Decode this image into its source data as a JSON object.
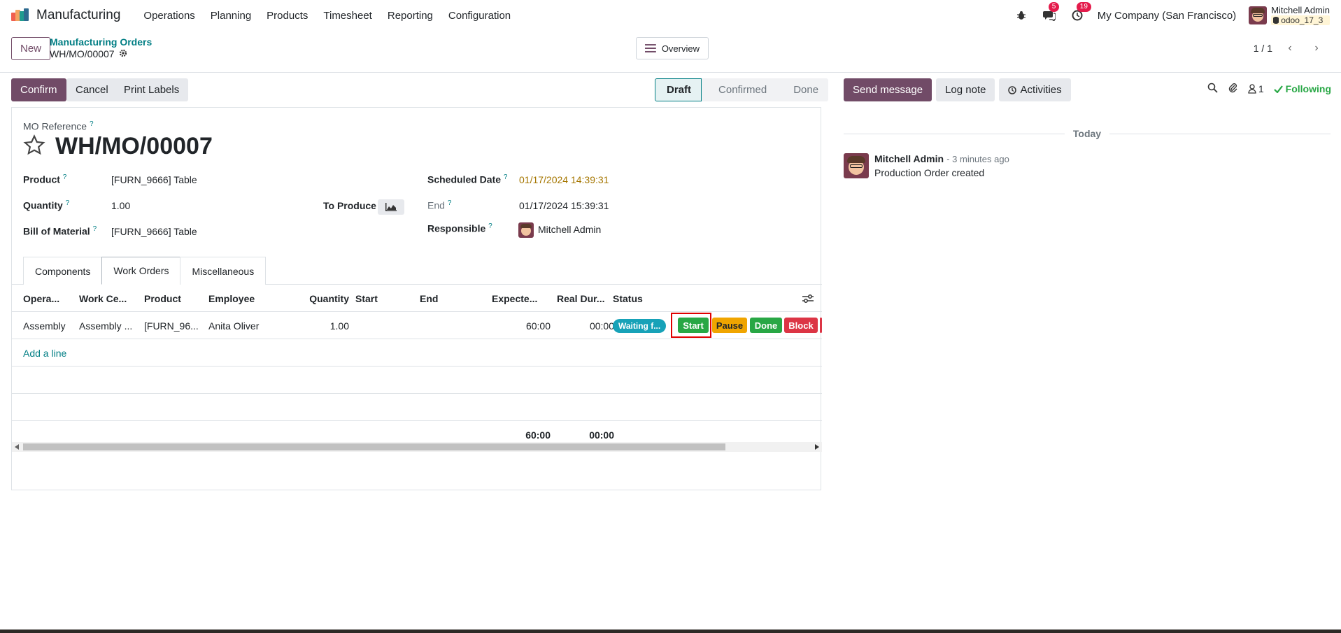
{
  "navbar": {
    "app_name": "Manufacturing",
    "menu": [
      "Operations",
      "Planning",
      "Products",
      "Timesheet",
      "Reporting",
      "Configuration"
    ],
    "messages_count": "5",
    "activities_count": "19",
    "company": "My Company (San Francisco)",
    "user_name": "Mitchell Admin",
    "database": "odoo_17_3"
  },
  "control_panel": {
    "new_label": "New",
    "breadcrumb_parent": "Manufacturing Orders",
    "breadcrumb_current": "WH/MO/00007",
    "overview_label": "Overview",
    "pager": "1 / 1"
  },
  "actions": {
    "confirm": "Confirm",
    "cancel": "Cancel",
    "print_labels": "Print Labels"
  },
  "status_stages": [
    {
      "label": "Draft",
      "active": true
    },
    {
      "label": "Confirmed",
      "active": false
    },
    {
      "label": "Done",
      "active": false
    }
  ],
  "form": {
    "mo_reference_label": "MO Reference",
    "mo_reference": "WH/MO/00007",
    "product_label": "Product",
    "product": "[FURN_9666] Table",
    "quantity_label": "Quantity",
    "quantity": "1.00",
    "to_produce_label": "To Produce",
    "bom_label": "Bill of Material",
    "bom": "[FURN_9666] Table",
    "scheduled_date_label": "Scheduled Date",
    "scheduled_date": "01/17/2024 14:39:31",
    "end_label": "End",
    "end": "01/17/2024 15:39:31",
    "responsible_label": "Responsible",
    "responsible": "Mitchell Admin",
    "help_mark": "?"
  },
  "tabs": [
    "Components",
    "Work Orders",
    "Miscellaneous"
  ],
  "work_orders": {
    "columns": [
      "Opera...",
      "Work Ce...",
      "Product",
      "Employee",
      "Quantity",
      "Start",
      "End",
      "Expecte...",
      "Real Dur...",
      "Status"
    ],
    "rows": [
      {
        "operation": "Assembly",
        "work_center": "Assembly ...",
        "product": "[FURN_96...",
        "employee": "Anita Oliver",
        "quantity": "1.00",
        "start": "",
        "end": "",
        "expected": "60:00",
        "real": "00:00",
        "status": "Waiting f...",
        "buttons": {
          "start": "Start",
          "pause": "Pause",
          "done": "Done",
          "block": "Block"
        }
      }
    ],
    "add_line": "Add a line",
    "total_expected": "60:00",
    "total_real": "00:00"
  },
  "chatter": {
    "send_message": "Send message",
    "log_note": "Log note",
    "activities": "Activities",
    "followers_count": "1",
    "following": "Following",
    "date_separator": "Today",
    "message": {
      "author": "Mitchell Admin",
      "time": "- 3 minutes ago",
      "body": "Production Order created"
    }
  },
  "colors": {
    "primary": "#714b67",
    "link": "#017e84",
    "start": "#28a745",
    "pause": "#f0a500",
    "done": "#28a745",
    "block": "#dc3545"
  }
}
